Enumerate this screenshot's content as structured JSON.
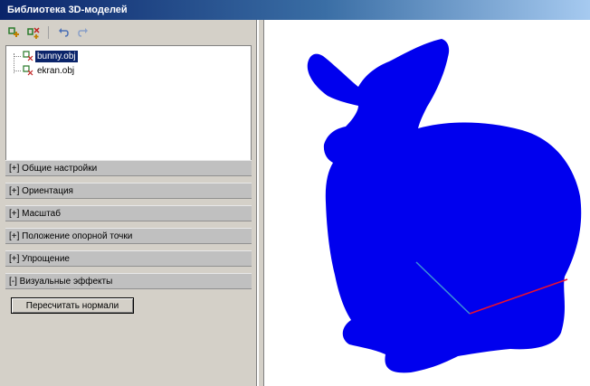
{
  "window": {
    "title": "Библиотека 3D-моделей"
  },
  "toolbar": {
    "buttons": [
      {
        "icon": "add-model-icon"
      },
      {
        "icon": "add-folder-icon"
      },
      {
        "icon": "undo-icon"
      },
      {
        "icon": "redo-icon"
      }
    ]
  },
  "tree": {
    "items": [
      {
        "label": "bunny.obj",
        "selected": true
      },
      {
        "label": "ekran.obj",
        "selected": false
      }
    ]
  },
  "panels": [
    {
      "label": "[+] Общие настройки"
    },
    {
      "label": "[+] Ориентация"
    },
    {
      "label": "[+] Масштаб"
    },
    {
      "label": "[+] Положение опорной точки"
    },
    {
      "label": "[+] Упрощение"
    },
    {
      "label": "[-] Визуальные эффекты"
    }
  ],
  "effects": {
    "recalc_button": "Пересчитать нормали"
  },
  "viewport": {
    "model_color": "#0000ee",
    "axis_colors": {
      "x": "#e81030",
      "y": "#3a8fd8"
    }
  }
}
